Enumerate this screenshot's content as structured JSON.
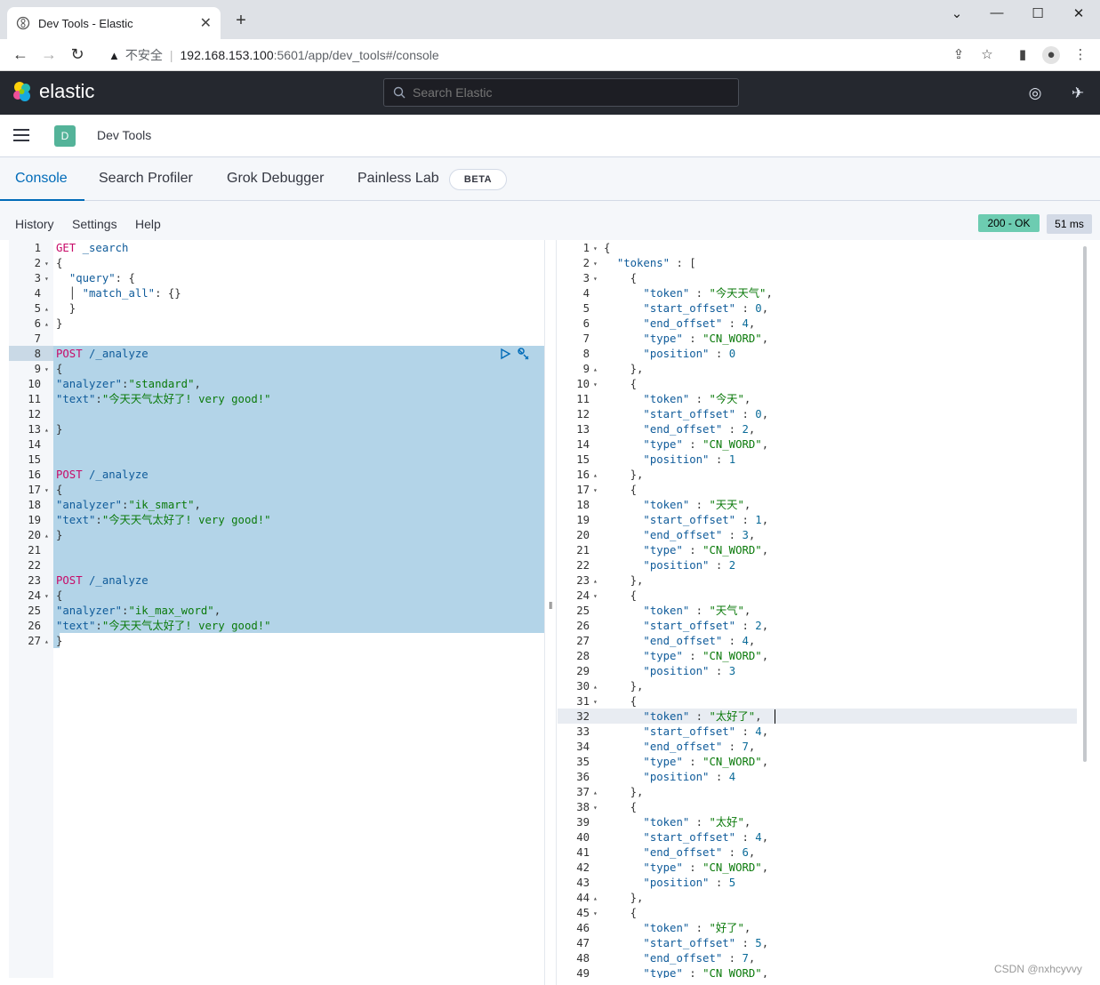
{
  "browser": {
    "tab_title": "Dev Tools - Elastic",
    "insecure_label": "不安全",
    "url_host": "192.168.153.100",
    "url_path": ":5601/app/dev_tools#/console"
  },
  "kibana": {
    "logo_text": "elastic",
    "search_placeholder": "Search Elastic",
    "space_initial": "D",
    "breadcrumb": "Dev Tools"
  },
  "tabs": [
    {
      "label": "Console",
      "active": true
    },
    {
      "label": "Search Profiler",
      "active": false
    },
    {
      "label": "Grok Debugger",
      "active": false
    },
    {
      "label": "Painless Lab",
      "active": false
    }
  ],
  "beta_badge": "BETA",
  "console_menu": {
    "history": "History",
    "settings": "Settings",
    "help": "Help"
  },
  "status": {
    "code": "200 - OK",
    "time": "51 ms"
  },
  "request_lines": [
    [
      [
        "m",
        "GET"
      ],
      [
        "u",
        " _search"
      ]
    ],
    [
      [
        "p",
        "{"
      ]
    ],
    [
      [
        "p",
        "  "
      ],
      [
        "k",
        "\"query\""
      ],
      [
        "p",
        ": {"
      ]
    ],
    [
      [
        "p",
        "  │ "
      ],
      [
        "k",
        "\"match_all\""
      ],
      [
        "p",
        ": {}"
      ]
    ],
    [
      [
        "p",
        "  }"
      ]
    ],
    [
      [
        "p",
        "}"
      ]
    ],
    [],
    [
      [
        "m",
        "POST"
      ],
      [
        "u",
        " /_analyze"
      ]
    ],
    [
      [
        "p",
        "{"
      ]
    ],
    [
      [
        "k",
        "\"analyzer\""
      ],
      [
        "p",
        ":"
      ],
      [
        "s",
        "\"standard\""
      ],
      [
        "p",
        ","
      ]
    ],
    [
      [
        "k",
        "\"text\""
      ],
      [
        "p",
        ":"
      ],
      [
        "s",
        "\"今天天气太好了! very good!\""
      ]
    ],
    [],
    [
      [
        "p",
        "}"
      ]
    ],
    [],
    [],
    [
      [
        "m",
        "POST"
      ],
      [
        "u",
        " /_analyze"
      ]
    ],
    [
      [
        "p",
        "{"
      ]
    ],
    [
      [
        "k",
        "\"analyzer\""
      ],
      [
        "p",
        ":"
      ],
      [
        "s",
        "\"ik_smart\""
      ],
      [
        "p",
        ","
      ]
    ],
    [
      [
        "k",
        "\"text\""
      ],
      [
        "p",
        ":"
      ],
      [
        "s",
        "\"今天天气太好了! very good!\""
      ]
    ],
    [
      [
        "p",
        "}"
      ]
    ],
    [],
    [],
    [
      [
        "m",
        "POST"
      ],
      [
        "u",
        " /_analyze"
      ]
    ],
    [
      [
        "p",
        "{"
      ]
    ],
    [
      [
        "k",
        "\"analyzer\""
      ],
      [
        "p",
        ":"
      ],
      [
        "s",
        "\"ik_max_word\""
      ],
      [
        "p",
        ","
      ]
    ],
    [
      [
        "k",
        "\"text\""
      ],
      [
        "p",
        ":"
      ],
      [
        "s",
        "\"今天天气太好了! very good!\""
      ]
    ],
    [
      [
        "p",
        "}"
      ]
    ]
  ],
  "request_folds": {
    "2": "▾",
    "3": "▾",
    "5": "▴",
    "6": "▴",
    "9": "▾",
    "13": "▴",
    "17": "▾",
    "20": "▴",
    "24": "▾",
    "27": "▴"
  },
  "response_lines": [
    [
      [
        "p",
        "{"
      ]
    ],
    [
      [
        "p",
        "  "
      ],
      [
        "k",
        "\"tokens\""
      ],
      [
        "p",
        " : ["
      ]
    ],
    [
      [
        "p",
        "    {"
      ]
    ],
    [
      [
        "p",
        "      "
      ],
      [
        "k",
        "\"token\""
      ],
      [
        "p",
        " : "
      ],
      [
        "s",
        "\"今天天气\""
      ],
      [
        "p",
        ","
      ]
    ],
    [
      [
        "p",
        "      "
      ],
      [
        "k",
        "\"start_offset\""
      ],
      [
        "p",
        " : "
      ],
      [
        "n",
        "0"
      ],
      [
        "p",
        ","
      ]
    ],
    [
      [
        "p",
        "      "
      ],
      [
        "k",
        "\"end_offset\""
      ],
      [
        "p",
        " : "
      ],
      [
        "n",
        "4"
      ],
      [
        "p",
        ","
      ]
    ],
    [
      [
        "p",
        "      "
      ],
      [
        "k",
        "\"type\""
      ],
      [
        "p",
        " : "
      ],
      [
        "s",
        "\"CN_WORD\""
      ],
      [
        "p",
        ","
      ]
    ],
    [
      [
        "p",
        "      "
      ],
      [
        "k",
        "\"position\""
      ],
      [
        "p",
        " : "
      ],
      [
        "n",
        "0"
      ]
    ],
    [
      [
        "p",
        "    },"
      ]
    ],
    [
      [
        "p",
        "    {"
      ]
    ],
    [
      [
        "p",
        "      "
      ],
      [
        "k",
        "\"token\""
      ],
      [
        "p",
        " : "
      ],
      [
        "s",
        "\"今天\""
      ],
      [
        "p",
        ","
      ]
    ],
    [
      [
        "p",
        "      "
      ],
      [
        "k",
        "\"start_offset\""
      ],
      [
        "p",
        " : "
      ],
      [
        "n",
        "0"
      ],
      [
        "p",
        ","
      ]
    ],
    [
      [
        "p",
        "      "
      ],
      [
        "k",
        "\"end_offset\""
      ],
      [
        "p",
        " : "
      ],
      [
        "n",
        "2"
      ],
      [
        "p",
        ","
      ]
    ],
    [
      [
        "p",
        "      "
      ],
      [
        "k",
        "\"type\""
      ],
      [
        "p",
        " : "
      ],
      [
        "s",
        "\"CN_WORD\""
      ],
      [
        "p",
        ","
      ]
    ],
    [
      [
        "p",
        "      "
      ],
      [
        "k",
        "\"position\""
      ],
      [
        "p",
        " : "
      ],
      [
        "n",
        "1"
      ]
    ],
    [
      [
        "p",
        "    },"
      ]
    ],
    [
      [
        "p",
        "    {"
      ]
    ],
    [
      [
        "p",
        "      "
      ],
      [
        "k",
        "\"token\""
      ],
      [
        "p",
        " : "
      ],
      [
        "s",
        "\"天天\""
      ],
      [
        "p",
        ","
      ]
    ],
    [
      [
        "p",
        "      "
      ],
      [
        "k",
        "\"start_offset\""
      ],
      [
        "p",
        " : "
      ],
      [
        "n",
        "1"
      ],
      [
        "p",
        ","
      ]
    ],
    [
      [
        "p",
        "      "
      ],
      [
        "k",
        "\"end_offset\""
      ],
      [
        "p",
        " : "
      ],
      [
        "n",
        "3"
      ],
      [
        "p",
        ","
      ]
    ],
    [
      [
        "p",
        "      "
      ],
      [
        "k",
        "\"type\""
      ],
      [
        "p",
        " : "
      ],
      [
        "s",
        "\"CN_WORD\""
      ],
      [
        "p",
        ","
      ]
    ],
    [
      [
        "p",
        "      "
      ],
      [
        "k",
        "\"position\""
      ],
      [
        "p",
        " : "
      ],
      [
        "n",
        "2"
      ]
    ],
    [
      [
        "p",
        "    },"
      ]
    ],
    [
      [
        "p",
        "    {"
      ]
    ],
    [
      [
        "p",
        "      "
      ],
      [
        "k",
        "\"token\""
      ],
      [
        "p",
        " : "
      ],
      [
        "s",
        "\"天气\""
      ],
      [
        "p",
        ","
      ]
    ],
    [
      [
        "p",
        "      "
      ],
      [
        "k",
        "\"start_offset\""
      ],
      [
        "p",
        " : "
      ],
      [
        "n",
        "2"
      ],
      [
        "p",
        ","
      ]
    ],
    [
      [
        "p",
        "      "
      ],
      [
        "k",
        "\"end_offset\""
      ],
      [
        "p",
        " : "
      ],
      [
        "n",
        "4"
      ],
      [
        "p",
        ","
      ]
    ],
    [
      [
        "p",
        "      "
      ],
      [
        "k",
        "\"type\""
      ],
      [
        "p",
        " : "
      ],
      [
        "s",
        "\"CN_WORD\""
      ],
      [
        "p",
        ","
      ]
    ],
    [
      [
        "p",
        "      "
      ],
      [
        "k",
        "\"position\""
      ],
      [
        "p",
        " : "
      ],
      [
        "n",
        "3"
      ]
    ],
    [
      [
        "p",
        "    },"
      ]
    ],
    [
      [
        "p",
        "    {"
      ]
    ],
    [
      [
        "p",
        "      "
      ],
      [
        "k",
        "\"token\""
      ],
      [
        "p",
        " : "
      ],
      [
        "s",
        "\"太好了\""
      ],
      [
        "p",
        ","
      ]
    ],
    [
      [
        "p",
        "      "
      ],
      [
        "k",
        "\"start_offset\""
      ],
      [
        "p",
        " : "
      ],
      [
        "n",
        "4"
      ],
      [
        "p",
        ","
      ]
    ],
    [
      [
        "p",
        "      "
      ],
      [
        "k",
        "\"end_offset\""
      ],
      [
        "p",
        " : "
      ],
      [
        "n",
        "7"
      ],
      [
        "p",
        ","
      ]
    ],
    [
      [
        "p",
        "      "
      ],
      [
        "k",
        "\"type\""
      ],
      [
        "p",
        " : "
      ],
      [
        "s",
        "\"CN_WORD\""
      ],
      [
        "p",
        ","
      ]
    ],
    [
      [
        "p",
        "      "
      ],
      [
        "k",
        "\"position\""
      ],
      [
        "p",
        " : "
      ],
      [
        "n",
        "4"
      ]
    ],
    [
      [
        "p",
        "    },"
      ]
    ],
    [
      [
        "p",
        "    {"
      ]
    ],
    [
      [
        "p",
        "      "
      ],
      [
        "k",
        "\"token\""
      ],
      [
        "p",
        " : "
      ],
      [
        "s",
        "\"太好\""
      ],
      [
        "p",
        ","
      ]
    ],
    [
      [
        "p",
        "      "
      ],
      [
        "k",
        "\"start_offset\""
      ],
      [
        "p",
        " : "
      ],
      [
        "n",
        "4"
      ],
      [
        "p",
        ","
      ]
    ],
    [
      [
        "p",
        "      "
      ],
      [
        "k",
        "\"end_offset\""
      ],
      [
        "p",
        " : "
      ],
      [
        "n",
        "6"
      ],
      [
        "p",
        ","
      ]
    ],
    [
      [
        "p",
        "      "
      ],
      [
        "k",
        "\"type\""
      ],
      [
        "p",
        " : "
      ],
      [
        "s",
        "\"CN_WORD\""
      ],
      [
        "p",
        ","
      ]
    ],
    [
      [
        "p",
        "      "
      ],
      [
        "k",
        "\"position\""
      ],
      [
        "p",
        " : "
      ],
      [
        "n",
        "5"
      ]
    ],
    [
      [
        "p",
        "    },"
      ]
    ],
    [
      [
        "p",
        "    {"
      ]
    ],
    [
      [
        "p",
        "      "
      ],
      [
        "k",
        "\"token\""
      ],
      [
        "p",
        " : "
      ],
      [
        "s",
        "\"好了\""
      ],
      [
        "p",
        ","
      ]
    ],
    [
      [
        "p",
        "      "
      ],
      [
        "k",
        "\"start_offset\""
      ],
      [
        "p",
        " : "
      ],
      [
        "n",
        "5"
      ],
      [
        "p",
        ","
      ]
    ],
    [
      [
        "p",
        "      "
      ],
      [
        "k",
        "\"end_offset\""
      ],
      [
        "p",
        " : "
      ],
      [
        "n",
        "7"
      ],
      [
        "p",
        ","
      ]
    ],
    [
      [
        "p",
        "      "
      ],
      [
        "k",
        "\"type\""
      ],
      [
        "p",
        " : "
      ],
      [
        "s",
        "\"CN_WORD\""
      ],
      [
        "p",
        ","
      ]
    ]
  ],
  "response_folds": {
    "1": "▾",
    "2": "▾",
    "3": "▾",
    "9": "▴",
    "10": "▾",
    "16": "▴",
    "17": "▾",
    "23": "▴",
    "24": "▾",
    "30": "▴",
    "31": "▾",
    "37": "▴",
    "38": "▾",
    "44": "▴",
    "45": "▾"
  },
  "watermark": "CSDN @nxhcyvvy"
}
